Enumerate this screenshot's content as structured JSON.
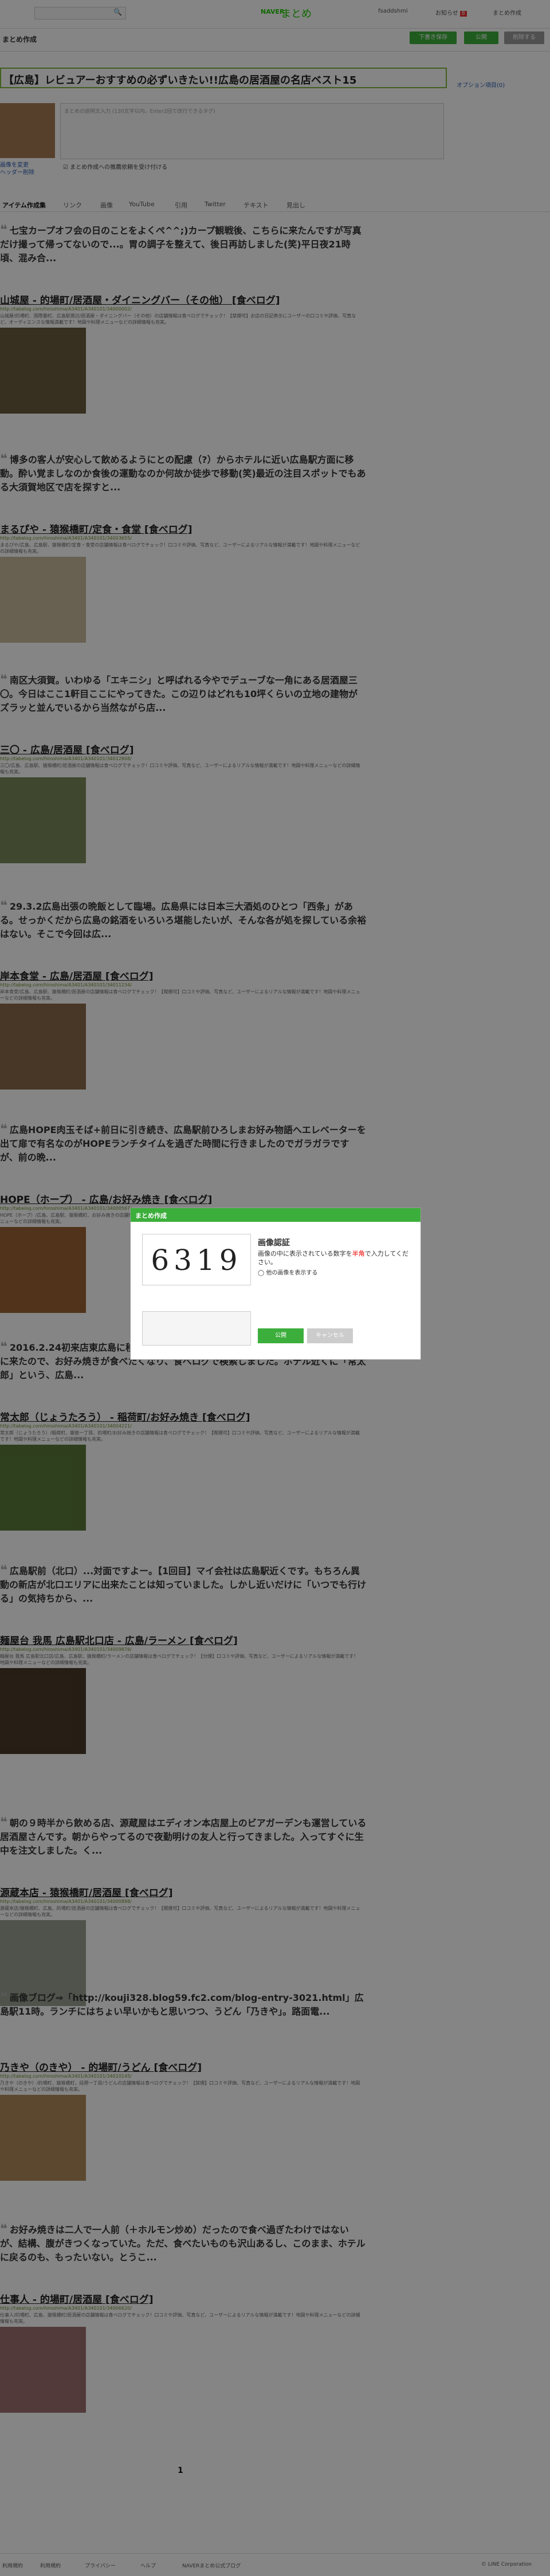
{
  "header": {
    "search_icon": "🔍",
    "naver": "NAVER",
    "logo": "まとめ",
    "user": "fsaddshmi",
    "notice": "お知らせ",
    "notice_count": "8",
    "mymatome": "まとめ作成"
  },
  "subheader": {
    "title": "まとめ作成",
    "save": "下書き保存",
    "publish": "公開",
    "delete": "削除する"
  },
  "editor": {
    "title": "【広島】レビュアーおすすめの必ずいきたい!!広島の居酒屋の名店ベスト15",
    "option": "オプション項目",
    "option_link": "(0)",
    "description_placeholder": "まとめの説明文入力 (130文字以内。Enter2回で改行できるタグ)",
    "profile_link1": "画像を変更",
    "profile_link2": "ヘッダー削除",
    "checkbox": "まとめ作成への推薦依頼を受け付ける"
  },
  "tabs": [
    "アイテム作成集",
    "リンク",
    "画像",
    "YouTube",
    "引用",
    "Twitter",
    "テキスト",
    "見出し"
  ],
  "items": [
    {
      "quote": "七宝カープオフ会の日のことをよくぺ^^;)カープ観戦後、こちらに来たんですが写真だけ撮って帰ってないので...。胃の調子を整えて、後日再訪しました(笑)平日夜21時頃、混み合...",
      "title": "山城屋 - 的場町/居酒屋・ダイニングバー（その他） [食べログ]",
      "url": "http://tabelog.com/hiroshima/A3401/A340101/34000002/",
      "desc": "山城屋/的場町、国際番町、広島駅周辺/居酒屋・ダイニングバー（その他）の店舗情報は食べログでチェック！【禁煙可】お店の日記表示にユーザーの口コミや評価、写真など、オーディエンスな情報満載です！地図や料理メニューなどの詳細情報も充実。"
    },
    {
      "quote": "博多の客人が安心して飲めるようにとの配慮（?）からホテルに近い広島駅方面に移動。酔い覚ましなのか食後の運動なのか何故か徒歩で移動(笑)最近の注目スポットでもある大須賀地区で店を探すと...",
      "title": "まるぴや - 猿猴橋町/定食・食堂 [食べログ]",
      "url": "http://tabelog.com/hiroshima/A3401/A340101/34003655/",
      "desc": "まるぴや/広島、広島駅、猿猴橋町/定食・食堂の店舗情報は食べログでチェック！口コミや評価、写真など、ユーザーによるリアルな情報が満載です！地図や料理メニューなどの詳細情報も充実。"
    },
    {
      "quote": "南区大須賀。いわゆる「エキニシ」と呼ばれる今やでデューブな一角にある居酒屋三〇。今日はここ1軒目ここにやってきた。この辺りはどれも10坪くらいの立地の建物がズラッと並んでいるから当然ながら店...",
      "title": "三〇 - 広島/居酒屋 [食べログ]",
      "url": "http://tabelog.com/hiroshima/A3401/A340101/34012808/",
      "desc": "三〇/広島、広島駅、猿猴橋町/居酒屋の店舗情報は食べログでチェック！口コミや評価、写真など、ユーザーによるリアルな情報が満載です！地図や料理メニューなどの詳細情報も充実。"
    },
    {
      "quote": "29.3.2広島出張の晩飯として臨場。広島県には日本三大酒処のひとつ「西条」がある。せっかくだから広島の銘酒をいろいろ堪能したいが、そんな各が処を探している余裕はない。そこで今回は広...",
      "title": "岸本食堂 - 広島/居酒屋 [食べログ]",
      "url": "http://tabelog.com/hiroshima/A3401/A340101/34011234/",
      "desc": "岸本食堂/広島、広島駅、猿猴橋町/居酒屋の店舗情報は食べログでチェック！【喫煙可】口コミや評価、写真など、ユーザーによるリアルな情報が満載です！地図や料理メニューなどの詳細情報も充実。"
    },
    {
      "quote": "広島HOPE肉玉そば+前日に引き続き、広島駅前ひろしまお好み物語へエレベーターを出て扉で有名なのがHOPEランチタイムを過ぎた時間に行きましたのでガラガラですが、前の晩...",
      "title": "HOPE（ホープ） - 広島/お好み焼き [食べログ]",
      "url": "http://tabelog.com/hiroshima/A3401/A340101/34000567/",
      "desc": "HOPE（ホープ）/広島、広島駅、猿猴橋町、お好み焼きの店舗情報は食べログでチェック！口コミや評価、写真など、ユーザーによるリアルな情報が満載です！地図や料理メニューなどの詳細情報も充実。"
    },
    {
      "quote": "2016.2.24初来店東広島に移動...後、遅くなったので広島駅前で一杯と。本場、広島に来たので、お好み焼きが食べたくなり、食べログで検索しました。ホテル近くに「常太郎」という、広島...",
      "title": "常太郎（じょうたろう） - 稲荷町/お好み焼き [食べログ]",
      "url": "http://tabelog.com/hiroshima/A3401/A340101/34004221/",
      "desc": "常太郎（じょうたろう）/稲荷町、銀座一丁目、的場町/お好み焼きの店舗情報は食べログでチェック！【喫煙可】口コミや評価、写真など、ユーザーによるリアルな情報が満載です！地図や料理メニューなどの詳細情報も充実。"
    },
    {
      "quote": "広島駅前（北口）...対面ですよー。【1回目】マイ会社は広島駅近くです。もちろん異動の新店が北口エリアに出来たことは知っていました。しかし近いだけに「いつでも行ける」の気持ちから、...",
      "title": "麺屋台 我馬 広島駅北口店 - 広島/ラーメン [食べログ]",
      "url": "http://tabelog.com/hiroshima/A3401/A340101/34009876/",
      "desc": "麺屋台 我馬 広島駅北口店/広島、広島駅、猿猴橋町/ラーメンの店舗情報は食べログでチェック！【分煙】口コミや評価、写真など、ユーザーによるリアルな情報が満載です！地図や料理メニューなどの詳細情報も充実。"
    },
    {
      "quote": "朝の９時半から飲める店、源蔵屋はエディオン本店屋上のビアガーデンも運営している居酒屋さんです。朝からやってるので夜勤明けの友人と行ってきました。入ってすぐに生中を注文しました。く...",
      "title": "源蔵本店 - 猿猴橋町/居酒屋 [食べログ]",
      "url": "http://tabelog.com/hiroshima/A3401/A340101/34000888/",
      "desc": "源蔵本店/猿猴橋町、広島、的場町/居酒屋の店舗情報は食べログでチェック！【喫煙可】口コミや評価、写真など、ユーザーによるリアルな情報が満載です！地図や料理メニューなどの詳細情報も充実。"
    },
    {
      "quote": "画像ブログ⇒「http://kouji328.blog59.fc2.com/blog-entry-3021.html」広島駅11時。ランチにはちょい早いかもと思いつつ、うどん「乃きや」。路面電...",
      "title": "乃きや（のきや） - 的場町/うどん [食べログ]",
      "url": "http://tabelog.com/hiroshima/A3401/A340101/34010145/",
      "desc": "乃きや（のきや）/的場町、猿猴橋町、段原一丁目/うどんの店舗情報は食べログでチェック！【禁煙】口コミや評価、写真など、ユーザーによるリアルな情報が満載です！地図や料理メニューなどの詳細情報も充実。"
    },
    {
      "quote": "お好み焼きは二人で一人前（＋ホルモン炒め）だったので食べ過ぎたわけではないが、結構、腹がきつくなっていた。ただ、食べたいものも沢山あるし、このまま、ホテルに戻るのも、もったいない。とうこ...",
      "title": "仕事人 - 的場町/居酒屋 [食べログ]",
      "url": "http://tabelog.com/hiroshima/A3401/A340101/34006620/",
      "desc": "仕事人/的場町、広島、猿猴橋町/居酒屋の店舗情報は食べログでチェック！口コミや評価、写真など、ユーザーによるリアルな情報が満載です！地図や料理メニューなどの詳細情報も充実。"
    }
  ],
  "modal": {
    "header": "まとめ作成",
    "captcha": "6319",
    "title": "画像認証",
    "text_a": "画像の中に表示されている数字を",
    "text_red": "半角",
    "text_b": "で入力してください。",
    "refresh": "他の画像を表示する",
    "ok": "公開",
    "cancel": "キャンセル"
  },
  "pager": "1",
  "footer": [
    "利用規約",
    "利用規約",
    "プライバシー",
    "ヘルプ",
    "NAVERまとめ公式ブログ",
    "© LINE Corporation"
  ]
}
